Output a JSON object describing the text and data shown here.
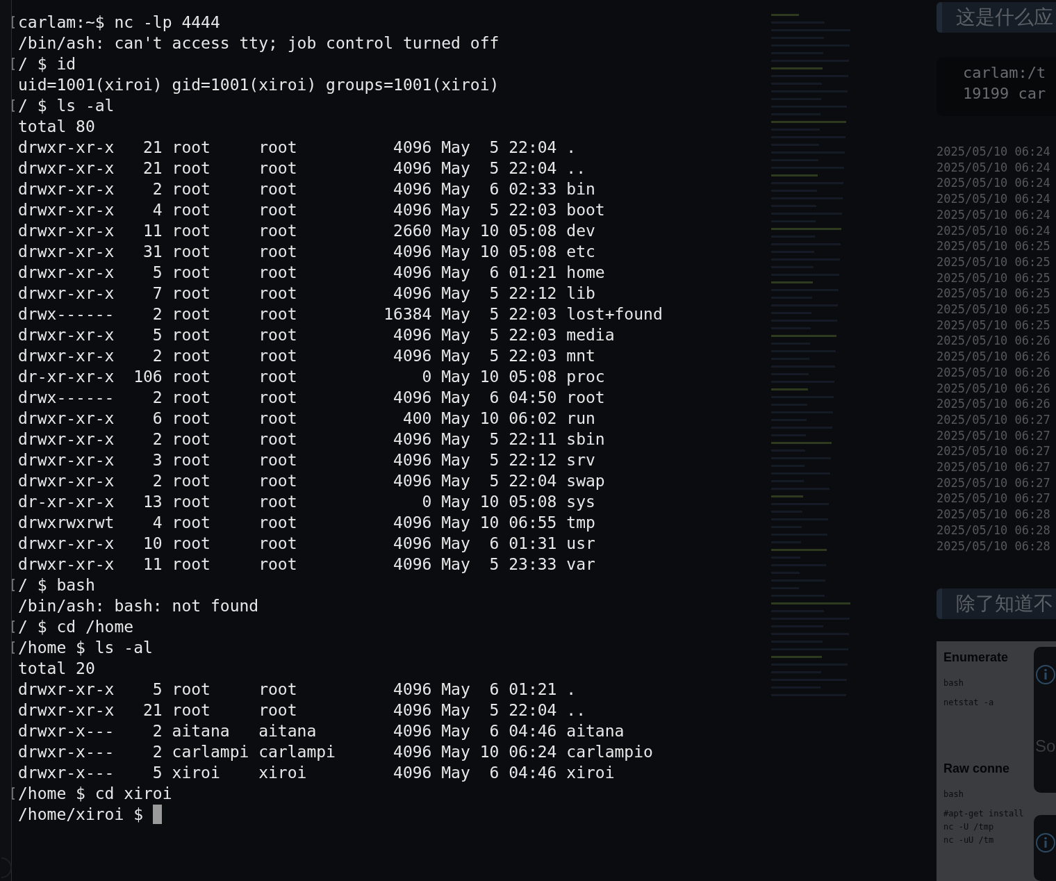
{
  "terminal": {
    "cursor_visible": true,
    "lines": [
      {
        "kind": "command",
        "text": "carlam:~$ nc -lp 4444"
      },
      {
        "kind": "output",
        "text": "/bin/ash: can't access tty; job control turned off"
      },
      {
        "kind": "command",
        "text": "/ $ id"
      },
      {
        "kind": "output",
        "text": "uid=1001(xiroi) gid=1001(xiroi) groups=1001(xiroi)"
      },
      {
        "kind": "command",
        "text": "/ $ ls -al"
      },
      {
        "kind": "output",
        "text": "total 80"
      },
      {
        "kind": "output",
        "text": "drwxr-xr-x   21 root     root          4096 May  5 22:04 ."
      },
      {
        "kind": "output",
        "text": "drwxr-xr-x   21 root     root          4096 May  5 22:04 .."
      },
      {
        "kind": "output",
        "text": "drwxr-xr-x    2 root     root          4096 May  6 02:33 bin"
      },
      {
        "kind": "output",
        "text": "drwxr-xr-x    4 root     root          4096 May  5 22:03 boot"
      },
      {
        "kind": "output",
        "text": "drwxr-xr-x   11 root     root          2660 May 10 05:08 dev"
      },
      {
        "kind": "output",
        "text": "drwxr-xr-x   31 root     root          4096 May 10 05:08 etc"
      },
      {
        "kind": "output",
        "text": "drwxr-xr-x    5 root     root          4096 May  6 01:21 home"
      },
      {
        "kind": "output",
        "text": "drwxr-xr-x    7 root     root          4096 May  5 22:12 lib"
      },
      {
        "kind": "output",
        "text": "drwx------    2 root     root         16384 May  5 22:03 lost+found"
      },
      {
        "kind": "output",
        "text": "drwxr-xr-x    5 root     root          4096 May  5 22:03 media"
      },
      {
        "kind": "output",
        "text": "drwxr-xr-x    2 root     root          4096 May  5 22:03 mnt"
      },
      {
        "kind": "output",
        "text": "dr-xr-xr-x  106 root     root             0 May 10 05:08 proc"
      },
      {
        "kind": "output",
        "text": "drwx------    2 root     root          4096 May  6 04:50 root"
      },
      {
        "kind": "output",
        "text": "drwxr-xr-x    6 root     root           400 May 10 06:02 run"
      },
      {
        "kind": "output",
        "text": "drwxr-xr-x    2 root     root          4096 May  5 22:11 sbin"
      },
      {
        "kind": "output",
        "text": "drwxr-xr-x    3 root     root          4096 May  5 22:12 srv"
      },
      {
        "kind": "output",
        "text": "drwxr-xr-x    2 root     root          4096 May  5 22:04 swap"
      },
      {
        "kind": "output",
        "text": "dr-xr-xr-x   13 root     root             0 May 10 05:08 sys"
      },
      {
        "kind": "output",
        "text": "drwxrwxrwt    4 root     root          4096 May 10 06:55 tmp"
      },
      {
        "kind": "output",
        "text": "drwxr-xr-x   10 root     root          4096 May  6 01:31 usr"
      },
      {
        "kind": "output",
        "text": "drwxr-xr-x   11 root     root          4096 May  5 23:33 var"
      },
      {
        "kind": "command",
        "text": "/ $ bash"
      },
      {
        "kind": "output",
        "text": "/bin/ash: bash: not found"
      },
      {
        "kind": "command",
        "text": "/ $ cd /home"
      },
      {
        "kind": "command",
        "text": "/home $ ls -al"
      },
      {
        "kind": "output",
        "text": "total 20"
      },
      {
        "kind": "output",
        "text": "drwxr-xr-x    5 root     root          4096 May  6 01:21 ."
      },
      {
        "kind": "output",
        "text": "drwxr-xr-x   21 root     root          4096 May  5 22:04 .."
      },
      {
        "kind": "output",
        "text": "drwxr-x---    2 aitana   aitana        4096 May  6 04:46 aitana"
      },
      {
        "kind": "output",
        "text": "drwxr-x---    2 carlampi carlampi      4096 May 10 06:24 carlampio"
      },
      {
        "kind": "output",
        "text": "drwxr-x---    5 xiroi    xiroi         4096 May  6 04:46 xiroi"
      },
      {
        "kind": "command",
        "text": "/home $ cd xiroi"
      },
      {
        "kind": "output",
        "text": "/home/xiroi $ "
      }
    ]
  },
  "side_panel": {
    "note_heading_1": "这是什么应",
    "code_image_lines": [
      "carlam:/t",
      "19199 car"
    ],
    "timestamps": [
      "2025/05/10 06:24",
      "2025/05/10 06:24",
      "2025/05/10 06:24",
      "2025/05/10 06:24",
      "2025/05/10 06:24",
      "2025/05/10 06:24",
      "2025/05/10 06:25",
      "2025/05/10 06:25",
      "2025/05/10 06:25",
      "2025/05/10 06:25",
      "2025/05/10 06:25",
      "2025/05/10 06:25",
      "2025/05/10 06:26",
      "2025/05/10 06:26",
      "2025/05/10 06:26",
      "2025/05/10 06:26",
      "2025/05/10 06:26",
      "2025/05/10 06:27",
      "2025/05/10 06:27",
      "2025/05/10 06:27",
      "2025/05/10 06:27",
      "2025/05/10 06:27",
      "2025/05/10 06:27",
      "2025/05/10 06:28",
      "2025/05/10 06:28",
      "2025/05/10 06:28"
    ],
    "note_heading_2": "除了知道不",
    "doc_sections": [
      {
        "title": "Enumerate",
        "code_label": "bash",
        "code_lines": [
          "netstat -a"
        ]
      },
      {
        "title": "Raw conne",
        "code_label": "bash",
        "code_lines": [
          "#apt-get install",
          "nc -U /tmp",
          "nc -uU /tm"
        ]
      }
    ],
    "popup_text": "So"
  }
}
